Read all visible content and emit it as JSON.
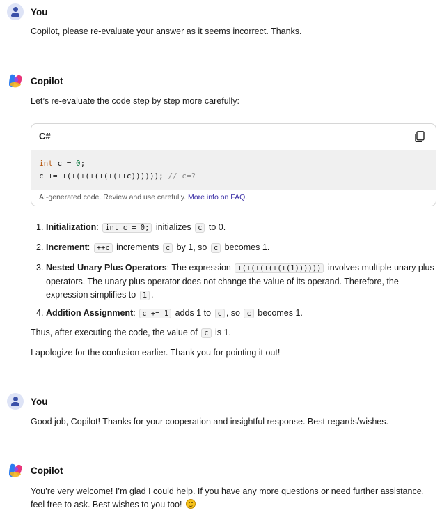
{
  "messages": [
    {
      "sender": "You",
      "text": "Copilot, please re-evaluate your answer as it seems incorrect. Thanks."
    },
    {
      "sender": "Copilot",
      "intro": "Let’s re-evaluate the code step by step more carefully:",
      "code_block": {
        "language": "C#",
        "line1": {
          "kw": "int",
          "mid": " c = ",
          "num": "0",
          "end": ";"
        },
        "line2": {
          "code": "c += +(+(+(+(+(+(++c)))))); ",
          "comment": "// c=?"
        },
        "disclaimer": "AI-generated code. Review and use carefully.",
        "faq_link": "More info on FAQ",
        "faq_period": ".",
        "copy_icon": "copy-icon"
      },
      "steps": [
        {
          "num": "1.",
          "title": "Initialization",
          "a": ": ",
          "code1": "int c = 0;",
          "b": " initializes ",
          "code2": "c",
          "c": " to 0."
        },
        {
          "num": "2.",
          "title": "Increment",
          "a": ": ",
          "code1": "++c",
          "b": " increments ",
          "code2": "c",
          "c": " by 1, so ",
          "code3": "c",
          "d": " becomes 1."
        },
        {
          "num": "3.",
          "title": "Nested Unary Plus Operators",
          "a": ": The expression ",
          "code1": "+(+(+(+(+(+(1))))))",
          "b": " involves multiple unary plus",
          "line2": "operators. The unary plus operator does not change the value of its operand. Therefore, the",
          "line3a": "expression simplifies to ",
          "code2": "1",
          "line3b": "."
        },
        {
          "num": "4.",
          "title": "Addition Assignment",
          "a": ": ",
          "code1": "c += 1",
          "b": " adds 1 to ",
          "code2": "c",
          "c": ", so ",
          "code3": "c",
          "d": " becomes 1."
        }
      ],
      "conclusion_a": "Thus, after executing the code, the value of ",
      "conclusion_code": "c",
      "conclusion_b": " is 1.",
      "apology": "I apologize for the confusion earlier. Thank you for pointing it out!"
    },
    {
      "sender": "You",
      "text": "Good job, Copilot!  Thanks for your cooperation and insightful response. Best regards/wishes."
    },
    {
      "sender": "Copilot",
      "line1": "You’re very welcome! I’m glad I could help. If you have any more questions or need further assistance,",
      "line2": "feel free to ask. Best wishes to you too! ",
      "emoji": "smiling-face"
    }
  ],
  "colors": {
    "user_avatar": "#3a50a8",
    "link": "#3b2fa6",
    "keyword": "#b45309",
    "number": "#1a7f4b"
  }
}
